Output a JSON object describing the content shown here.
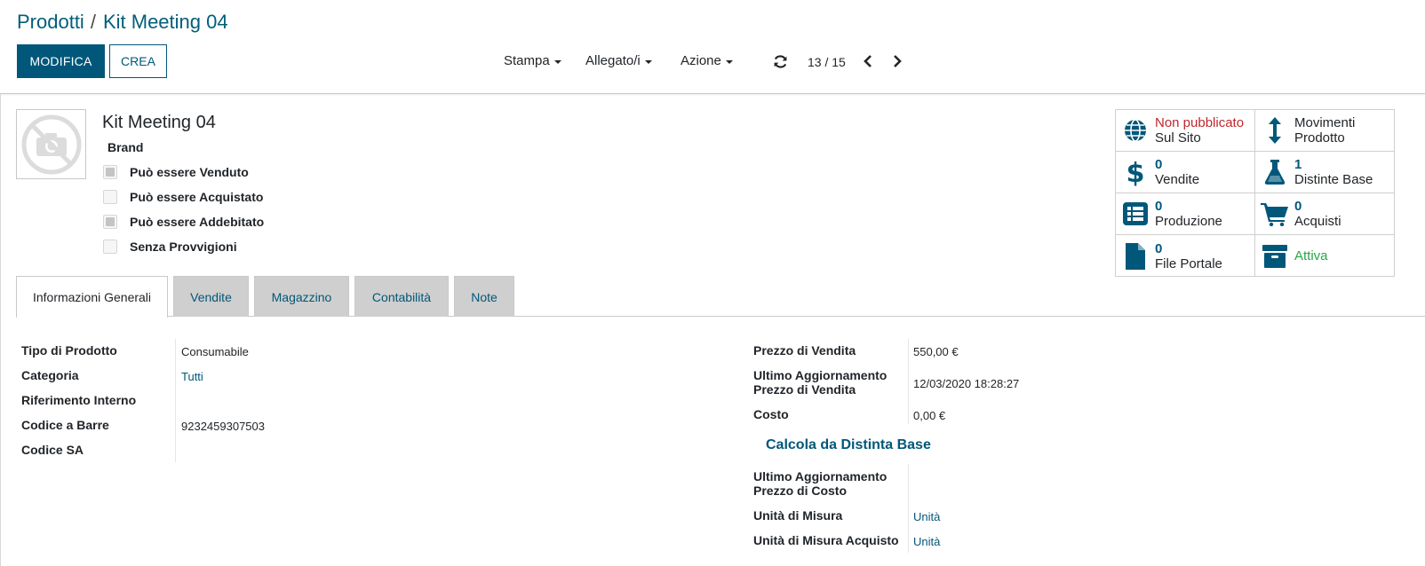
{
  "breadcrumb": {
    "parent": "Prodotti",
    "separator": "/",
    "current": "Kit Meeting 04"
  },
  "buttons": {
    "edit": "MODIFICA",
    "create": "CREA"
  },
  "menus": {
    "print": "Stampa",
    "attachments": "Allegato/i",
    "action": "Azione"
  },
  "pager": {
    "value": "13 / 15"
  },
  "product": {
    "name": "Kit Meeting 04",
    "brand": "Brand",
    "options": [
      {
        "label": "Può essere Venduto",
        "checked": true
      },
      {
        "label": "Può essere Acquistato",
        "checked": false
      },
      {
        "label": "Può essere Addebitato",
        "checked": true
      },
      {
        "label": "Senza Provvigioni",
        "checked": false
      }
    ]
  },
  "smart_buttons": {
    "website": {
      "status": "Non pubblicato",
      "label": "Sul Sito",
      "icon": "globe-icon",
      "status_color": "#c0272d"
    },
    "moves": {
      "line1": "Movimenti",
      "line2": "Prodotto",
      "icon": "arrows-v-icon"
    },
    "sales": {
      "count": "0",
      "label": "Vendite",
      "icon": "dollar-icon"
    },
    "bom": {
      "count": "1",
      "label": "Distinte Base",
      "icon": "flask-icon"
    },
    "production": {
      "count": "0",
      "label": "Produzione",
      "icon": "list-icon"
    },
    "purchases": {
      "count": "0",
      "label": "Acquisti",
      "icon": "cart-icon"
    },
    "portal_files": {
      "count": "0",
      "label": "File Portale",
      "icon": "file-icon"
    },
    "active": {
      "label": "Attiva",
      "icon": "archive-icon",
      "color": "#28a745"
    }
  },
  "tabs": [
    {
      "label": "Informazioni Generali",
      "active": true
    },
    {
      "label": "Vendite",
      "active": false
    },
    {
      "label": "Magazzino",
      "active": false
    },
    {
      "label": "Contabilità",
      "active": false
    },
    {
      "label": "Note",
      "active": false
    }
  ],
  "general_info": {
    "left": [
      {
        "label": "Tipo di Prodotto",
        "value": "Consumabile"
      },
      {
        "label": "Categoria",
        "value": "Tutti"
      },
      {
        "label": "Riferimento Interno",
        "value": ""
      },
      {
        "label": "Codice a Barre",
        "value": "9232459307503"
      },
      {
        "label": "Codice SA",
        "value": ""
      }
    ],
    "right": [
      {
        "label": "Prezzo di Vendita",
        "value": "550,00 €"
      },
      {
        "label": "Ultimo Aggiornamento Prezzo di Vendita",
        "value": "12/03/2020 18:28:27"
      },
      {
        "label": "Costo",
        "value": "0,00 €"
      },
      {
        "label": "Ultimo Aggiornamento Prezzo di Costo",
        "value": ""
      },
      {
        "label": "Unità di Misura",
        "value": "Unità"
      },
      {
        "label": "Unità di Misura Acquisto",
        "value": "Unità"
      }
    ],
    "compute_bom": "Calcola da Distinta Base"
  },
  "colors": {
    "brand": "#01577a",
    "link": "#01577a",
    "inactive_tab": "#cfcfcf"
  }
}
